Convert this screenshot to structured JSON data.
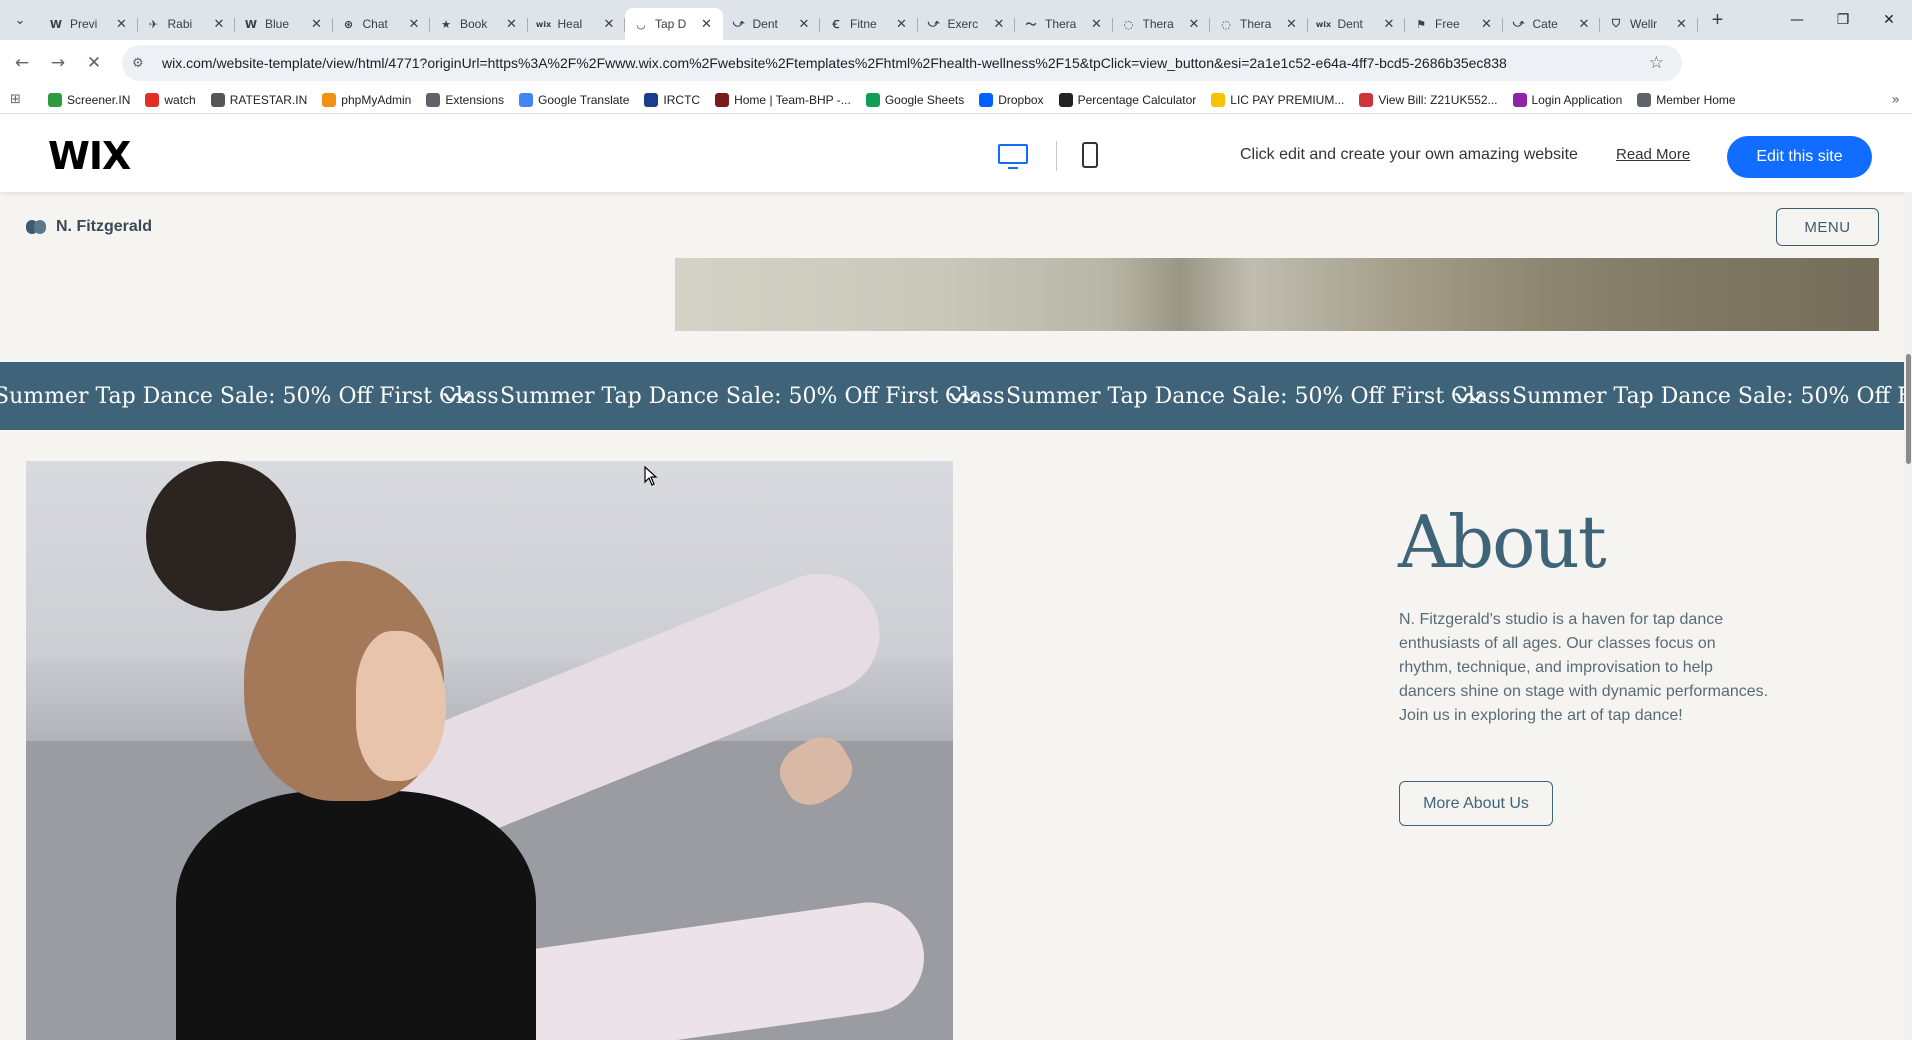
{
  "browser": {
    "tabs": [
      {
        "icon": "W",
        "title": "Previ"
      },
      {
        "icon": "✈",
        "title": "Rabi"
      },
      {
        "icon": "W",
        "title": "Blue"
      },
      {
        "icon": "⊛",
        "title": "Chat"
      },
      {
        "icon": "★",
        "title": "Book"
      },
      {
        "icon": "wix",
        "title": "Heal"
      },
      {
        "icon": "◡",
        "title": "Tap D"
      },
      {
        "icon": "⤻",
        "title": "Dent"
      },
      {
        "icon": "Ꞓ",
        "title": "Fitne"
      },
      {
        "icon": "⤻",
        "title": "Exerc"
      },
      {
        "icon": "〜",
        "title": "Thera"
      },
      {
        "icon": "◌",
        "title": "Thera"
      },
      {
        "icon": "◌",
        "title": "Thera"
      },
      {
        "icon": "wix",
        "title": "Dent"
      },
      {
        "icon": "⚑",
        "title": "Free"
      },
      {
        "icon": "⤻",
        "title": "Cate"
      },
      {
        "icon": "⛉",
        "title": "Wellr"
      }
    ],
    "active_tab_index": 6,
    "url": "wix.com/website-template/view/html/4771?originUrl=https%3A%2F%2Fwww.wix.com%2Fwebsite%2Ftemplates%2Fhtml%2Fhealth-wellness%2F15&tpClick=view_button&esi=2a1e1c52-e64a-4ff7-bcd5-2686b35ec838",
    "bookmarks": [
      {
        "label": "Screener.IN",
        "color": "#2e9b3e"
      },
      {
        "label": "watch",
        "color": "#e52d27"
      },
      {
        "label": "RATESTAR.IN",
        "color": "#555555"
      },
      {
        "label": "phpMyAdmin",
        "color": "#f29111"
      },
      {
        "label": "Extensions",
        "color": "#5f6368"
      },
      {
        "label": "Google Translate",
        "color": "#4285f4"
      },
      {
        "label": "IRCTC",
        "color": "#1a3d8f"
      },
      {
        "label": "Home | Team-BHP -...",
        "color": "#7a1b1b"
      },
      {
        "label": "Google Sheets",
        "color": "#0f9d58"
      },
      {
        "label": "Dropbox",
        "color": "#0061fe"
      },
      {
        "label": "Percentage Calculator",
        "color": "#222222"
      },
      {
        "label": "LIC PAY PREMIUM...",
        "color": "#f5c400"
      },
      {
        "label": "View Bill: Z21UK552...",
        "color": "#d13438"
      },
      {
        "label": "Login Application",
        "color": "#8e24aa"
      },
      {
        "label": "Member Home",
        "color": "#5f6368"
      }
    ]
  },
  "wix_bar": {
    "logo": "WIX",
    "tagline": "Click edit and create your own amazing website",
    "read_more": "Read More",
    "edit_button": "Edit this site"
  },
  "site": {
    "brand": "N. Fitzgerald",
    "menu_button": "MENU",
    "marquee_text": "Summer Tap Dance Sale: 50% Off First Class",
    "marquee_separator": "〰",
    "about": {
      "title": "About",
      "body": "N. Fitzgerald's studio is a haven for tap dance enthusiasts of all ages. Our classes focus on rhythm, technique, and improvisation to help dancers shine on stage with dynamic performances. Join us in exploring the art of tap dance!",
      "button": "More About Us"
    }
  },
  "colors": {
    "accent": "#3f6479",
    "wix_blue": "#116dff",
    "page_bg": "#f5f4f0"
  }
}
